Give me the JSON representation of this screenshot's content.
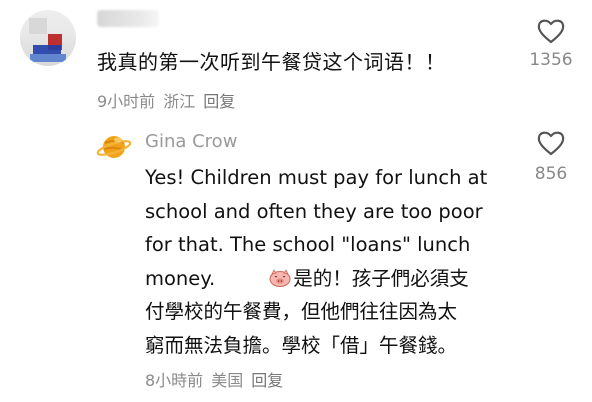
{
  "comment": {
    "text": "我真的第一次听到午餐贷这个词语！！",
    "time": "9小时前",
    "location": "浙江",
    "reply_label": "回复",
    "likes": "1356",
    "like_icon": "heart-outline-icon"
  },
  "reply": {
    "username": "Gina Crow",
    "avatar_icon": "planet-icon",
    "lines": [
      "Yes! Children must pay for lunch at",
      "school and often they are too poor",
      "for that. The school \"loans\" lunch",
      "money.",
      "付學校的午餐費，但他們往往因為太",
      "窮而無法負擔。學校「借」午餐錢。"
    ],
    "inline_after_money": "是的！孩子們必須支",
    "emoji_icon": "piggy-face-emoji-icon",
    "time": "8小時前",
    "location": "美国",
    "reply_label": "回复",
    "likes": "856",
    "like_icon": "heart-outline-icon"
  },
  "colors": {
    "text": "#111111",
    "meta": "#8b8b8b",
    "username": "#9a9a9a",
    "icon_stroke": "#555555"
  }
}
